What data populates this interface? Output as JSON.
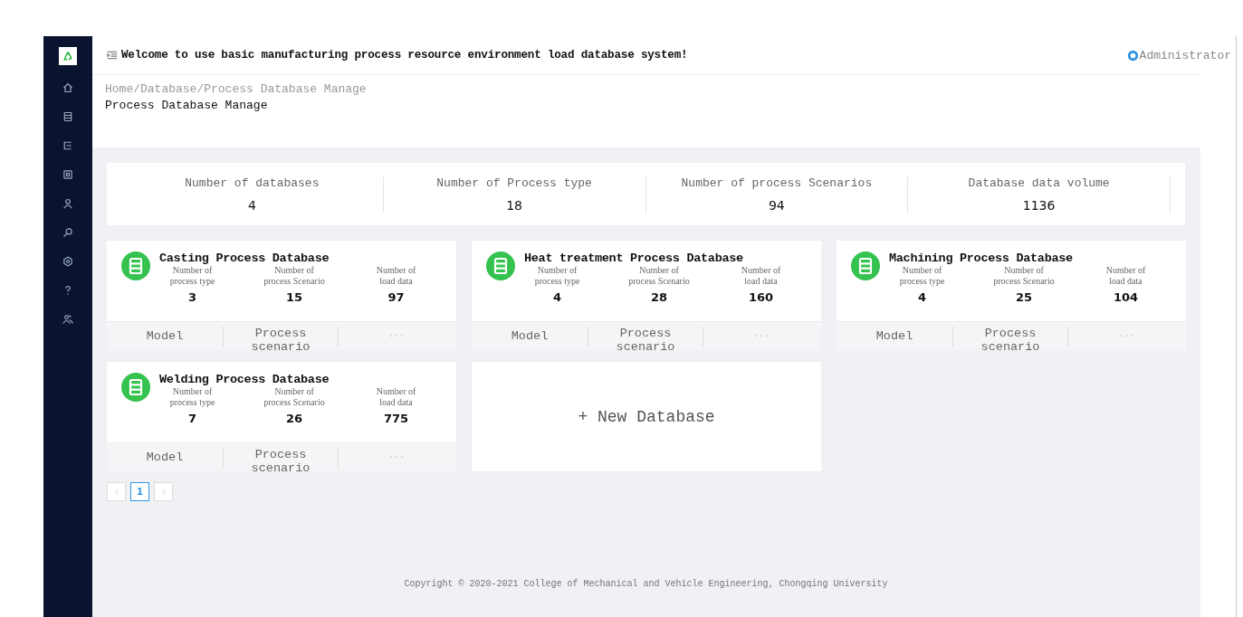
{
  "header": {
    "welcome": "Welcome to use basic manufacturing process resource environment load database system!",
    "user": "Administrator"
  },
  "breadcrumb": "Home/Database/Process Database Manage",
  "page_title": "Process Database Manage",
  "stats": [
    {
      "label": "Number of databases",
      "value": "4"
    },
    {
      "label": "Number of Process type",
      "value": "18"
    },
    {
      "label": "Number of process Scenarios",
      "value": "94"
    },
    {
      "label": "Database data volume",
      "value": "1136"
    }
  ],
  "databases": [
    {
      "name": "Casting Process Database",
      "metrics": [
        {
          "label": "Number of\nprocess type",
          "value": "3"
        },
        {
          "label": "Number of\nprocess Scenario",
          "value": "15"
        },
        {
          "label": "Number of\nload data",
          "value": "97"
        }
      ],
      "actions": [
        "Model",
        "Process scenario",
        "···"
      ]
    },
    {
      "name": "Heat treatment Process Database",
      "metrics": [
        {
          "label": "Number of\nprocess type",
          "value": "4"
        },
        {
          "label": "Number of\nprocess Scenario",
          "value": "28"
        },
        {
          "label": "Number of\nload data",
          "value": "160"
        }
      ],
      "actions": [
        "Model",
        "Process scenario",
        "···"
      ]
    },
    {
      "name": "Machining Process Database",
      "metrics": [
        {
          "label": "Number of\nprocess type",
          "value": "4"
        },
        {
          "label": "Number of\nprocess Scenario",
          "value": "25"
        },
        {
          "label": "Number of\nload data",
          "value": "104"
        }
      ],
      "actions": [
        "Model",
        "Process scenario",
        "···"
      ]
    },
    {
      "name": "Welding Process Database",
      "metrics": [
        {
          "label": "Number of\nprocess type",
          "value": "7"
        },
        {
          "label": "Number of\nprocess Scenario",
          "value": "26"
        },
        {
          "label": "Number of\nload data",
          "value": "775"
        }
      ],
      "actions": [
        "Model",
        "Process scenario",
        "···"
      ]
    }
  ],
  "new_database": "+ New Database",
  "pagination": {
    "pages": [
      {
        "label": "1",
        "selected": true
      }
    ]
  },
  "copyright": "Copyright © 2020-2021 College of Mechanical and Vehicle Engineering, Chongqing University"
}
